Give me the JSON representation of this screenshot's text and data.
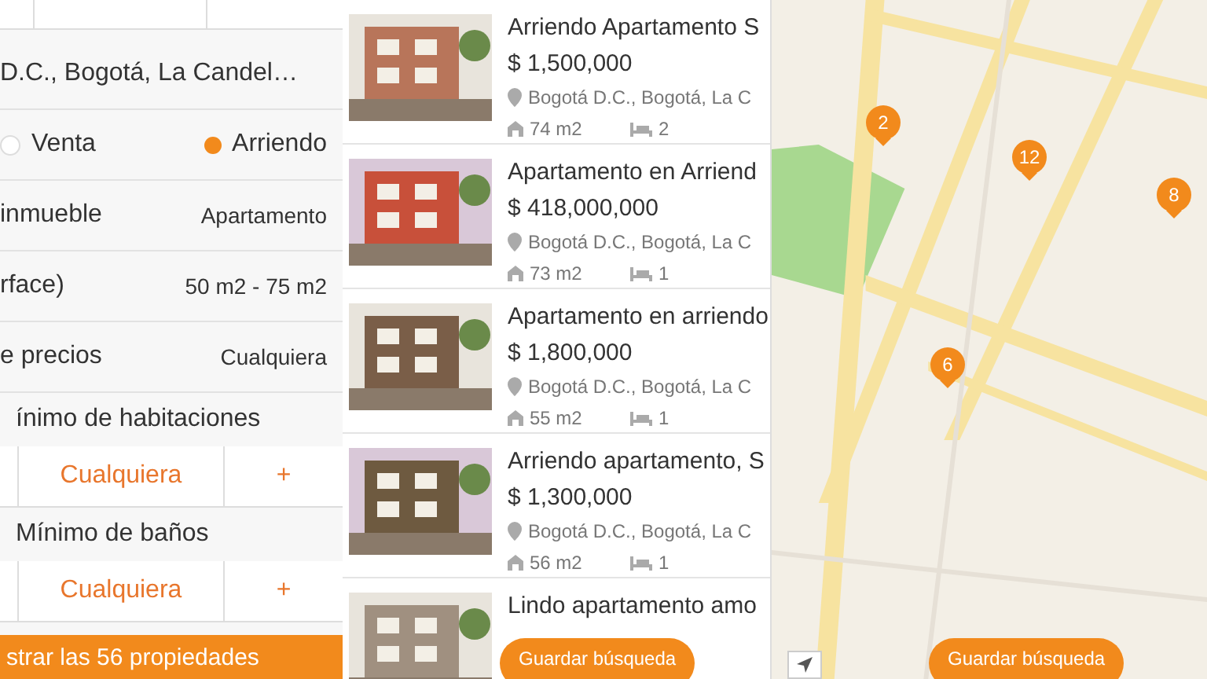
{
  "filters": {
    "location": "D.C., Bogotá, La Candel…",
    "operation": [
      {
        "label": "Venta",
        "selected": false
      },
      {
        "label": "Arriendo",
        "selected": true
      }
    ],
    "rows": [
      {
        "label": "inmueble",
        "value": "Apartamento"
      },
      {
        "label": "rface)",
        "value": "50 m2 - 75 m2"
      },
      {
        "label": "e precios",
        "value": "Cualquiera"
      }
    ],
    "steppers": [
      {
        "label": "ínimo de habitaciones",
        "value": "Cualquiera",
        "plus": "+"
      },
      {
        "label": "Mínimo de baños",
        "value": "Cualquiera",
        "plus": "+"
      }
    ],
    "submit": "strar las 56 propiedades"
  },
  "listings": [
    {
      "title": "Arriendo Apartamento S",
      "price": "$ 1,500,000",
      "location": "Bogotá D.C., Bogotá, La C",
      "area": "74 m2",
      "rooms": "2"
    },
    {
      "title": "Apartamento en Arriend",
      "price": "$ 418,000,000",
      "location": "Bogotá D.C., Bogotá, La C",
      "area": "73 m2",
      "rooms": "1"
    },
    {
      "title": "Apartamento en arriendo",
      "price": "$ 1,800,000",
      "location": "Bogotá D.C., Bogotá, La C",
      "area": "55 m2",
      "rooms": "1"
    },
    {
      "title": "Arriendo apartamento, S",
      "price": "$ 1,300,000",
      "location": "Bogotá D.C., Bogotá, La C",
      "area": "56 m2",
      "rooms": "1"
    },
    {
      "title": "Lindo apartamento amo"
    }
  ],
  "list_button": "Guardar búsqueda",
  "map": {
    "pins": [
      {
        "label": "2"
      },
      {
        "label": "12"
      },
      {
        "label": "8"
      },
      {
        "label": "6"
      }
    ],
    "button": "Guardar búsqueda"
  }
}
